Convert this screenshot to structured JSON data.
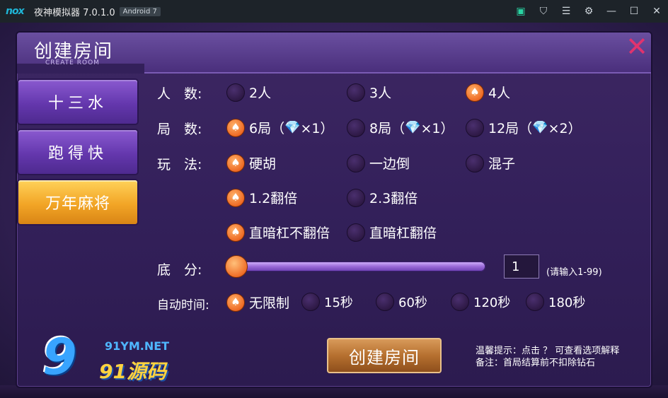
{
  "titlebar": {
    "logo": "nox",
    "title": "夜神模拟器 7.0.1.0",
    "badge": "Android 7",
    "icons": [
      "shop-icon",
      "shirt-icon",
      "menu-icon",
      "gear-icon",
      "minimize-icon",
      "maximize-icon",
      "close-icon"
    ]
  },
  "dialog": {
    "title": "创建房间",
    "subtitle": "CREATE ROOM",
    "close": "✕"
  },
  "tabs": [
    {
      "label": "十三水",
      "active": false
    },
    {
      "label": "跑得快",
      "active": false
    },
    {
      "label": "万年麻将",
      "active": true
    }
  ],
  "players": {
    "label": "人　数:",
    "options": [
      {
        "label": "2人",
        "selected": false
      },
      {
        "label": "3人",
        "selected": false
      },
      {
        "label": "4人",
        "selected": true
      }
    ]
  },
  "rounds": {
    "label": "局　数:",
    "options": [
      {
        "label": "6局（",
        "gem": "×1）",
        "selected": true
      },
      {
        "label": "8局（",
        "gem": "×1）",
        "selected": false
      },
      {
        "label": "12局（",
        "gem": "×2）",
        "selected": false
      }
    ]
  },
  "rules": {
    "label": "玩　法:",
    "options": [
      {
        "label": "硬胡",
        "selected": true
      },
      {
        "label": "一边倒",
        "selected": false
      },
      {
        "label": "混子",
        "selected": false
      },
      {
        "label": "1.2翻倍",
        "selected": true
      },
      {
        "label": "2.3翻倍",
        "selected": false
      },
      {
        "label": "直暗杠不翻倍",
        "selected": true
      },
      {
        "label": "直暗杠翻倍",
        "selected": false
      }
    ]
  },
  "score": {
    "label": "底　分:",
    "value": "1",
    "hint": "(请输入1-99)",
    "slider_fraction": 0
  },
  "autotime": {
    "label": "自动时间:",
    "options": [
      {
        "label": "无限制",
        "selected": true
      },
      {
        "label": "15秒",
        "selected": false
      },
      {
        "label": "60秒",
        "selected": false
      },
      {
        "label": "120秒",
        "selected": false
      },
      {
        "label": "180秒",
        "selected": false
      }
    ]
  },
  "create_button": "创建房间",
  "tips": {
    "line1": "温馨提示：点击 ？ 可查看选项解释",
    "line2": "备注：首局结算前不扣除钻石"
  },
  "watermark": {
    "nine": "9",
    "net": "91YM.NET",
    "cn": "91源码"
  },
  "colors": {
    "accent": "#ef6f28",
    "tab_active": "#f2a526",
    "tab_inactive": "#6437ad",
    "close": "#e0336e"
  }
}
